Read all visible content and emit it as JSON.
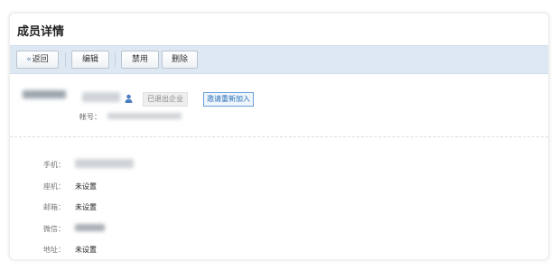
{
  "page": {
    "title": "成员详情"
  },
  "toolbar": {
    "back_label": "返回",
    "edit_label": "编辑",
    "disable_label": "禁用",
    "delete_label": "删除"
  },
  "member": {
    "status_badge": "已退出企业",
    "invite_label": "邀请重新加入",
    "account_label": "帐号："
  },
  "fields": {
    "mobile_label": "手机：",
    "landline_label": "座机：",
    "landline_value": "未设置",
    "email_label": "邮箱：",
    "email_value": "未设置",
    "wechat_label": "微信：",
    "address_label": "地址：",
    "address_value": "未设置"
  },
  "colors": {
    "toolbar_bg": "#dde8f3",
    "invite_border": "#6a9fd8",
    "invite_text": "#2a6eb8"
  }
}
